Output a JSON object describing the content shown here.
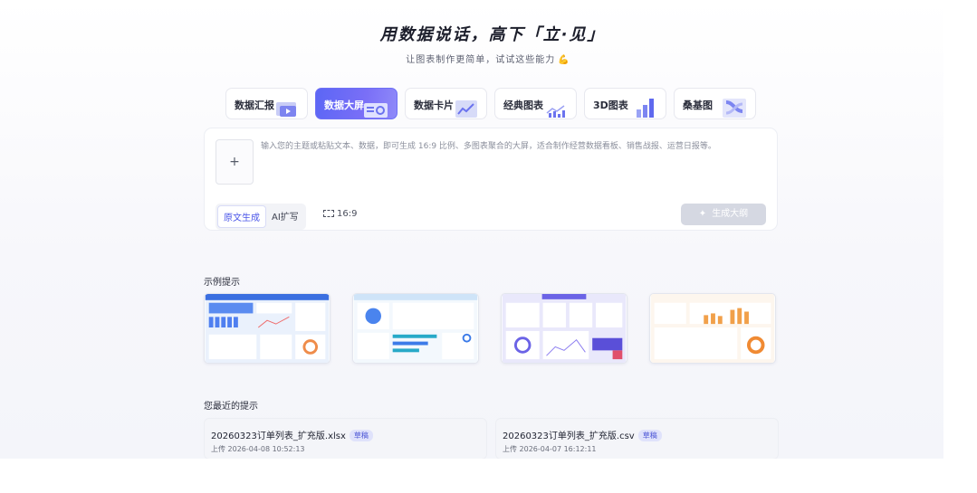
{
  "hero": {
    "title": "用数据说话，高下「立·见」",
    "subtitle": "让图表制作更简单，试试这些能力",
    "subtitle_icon": "flexed-biceps-icon"
  },
  "tabs": [
    {
      "label": "数据汇报",
      "icon": "report-slides-icon",
      "active": false
    },
    {
      "label": "数据大屏",
      "icon": "dashboard-screen-icon",
      "active": true
    },
    {
      "label": "数据卡片",
      "icon": "data-card-icon",
      "active": false
    },
    {
      "label": "经典图表",
      "icon": "classic-chart-icon",
      "active": false
    },
    {
      "label": "3D图表",
      "icon": "3d-bar-chart-icon",
      "active": false
    },
    {
      "label": "桑基图",
      "icon": "sankey-chart-icon",
      "active": false
    }
  ],
  "input": {
    "upload_label": "+",
    "placeholder": "输入您的主题或粘贴文本、数据，即可生成 16:9 比例、多图表聚合的大屏，适合制作经营数据看板、销售战报、运营日报等。",
    "modes": [
      "原文生成",
      "AI扩写"
    ],
    "active_mode": "原文生成",
    "ratio": "16:9",
    "generate_label": "生成大纲"
  },
  "examples": {
    "title": "示例提示",
    "cards": [
      "example-dashboard-blue",
      "example-dashboard-light",
      "example-dashboard-purple",
      "example-dashboard-orange"
    ]
  },
  "recent": {
    "title": "您最近的提示",
    "items": [
      {
        "name": "20260323订单列表_扩充版.xlsx",
        "badge": "草稿",
        "time": "上传 2026-04-08 10:52:13"
      },
      {
        "name": "20260323订单列表_扩充版.csv",
        "badge": "草稿",
        "time": "上传 2026-04-07 16:12:11"
      }
    ]
  },
  "colors": {
    "accent": "#5b66f5",
    "badge_bg": "#dfe2fb",
    "generate_disabled": "#d5d8e2"
  }
}
